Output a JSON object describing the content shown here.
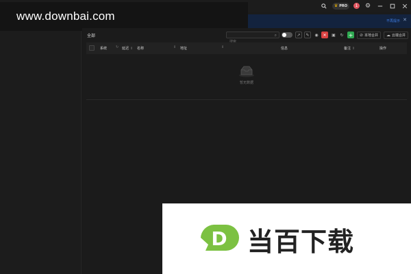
{
  "watermark_top": {
    "text": "www.downbai.com"
  },
  "titlebar": {
    "pro_label": "PRO",
    "notification_count": "1",
    "icons": [
      "search-icon",
      "crown-icon",
      "gear-icon",
      "minimize-icon",
      "maximize-icon",
      "close-icon"
    ]
  },
  "banner": {
    "no_remind_label": "不再提示",
    "close_label": "✕"
  },
  "toolbar": {
    "label": "全部",
    "search_placeholder": "搜索",
    "local_merge_label": "本地合并",
    "cloud_merge_label": "云端合并"
  },
  "table": {
    "columns": [
      "系统",
      "延迟",
      "名称",
      "地址",
      "信息",
      "备注",
      "操作"
    ],
    "empty_text": "暂无数据"
  },
  "watermark_bottom": {
    "logo_letter": "D",
    "text": "当百下载"
  },
  "colors": {
    "accent_red": "#d94242",
    "accent_green": "#2fa851",
    "banner_bg": "#13233e",
    "link": "#3d7de6"
  }
}
